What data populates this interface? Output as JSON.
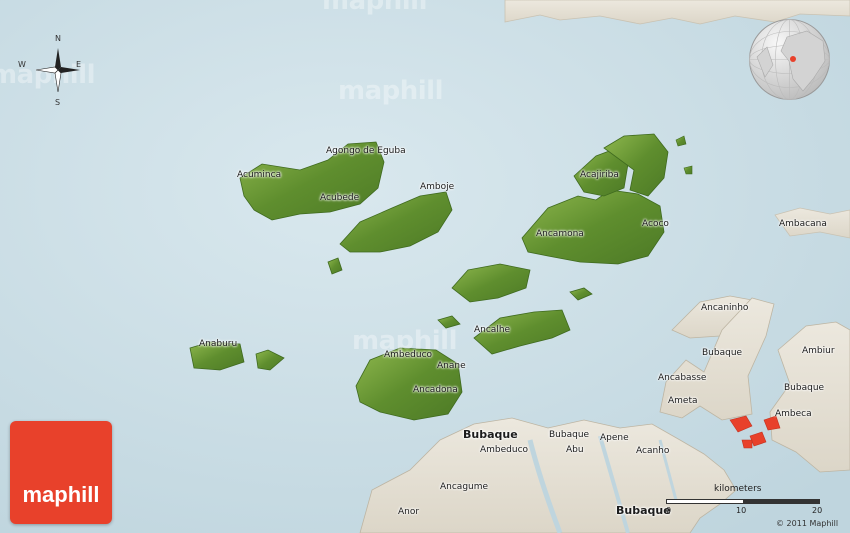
{
  "map": {
    "colors": {
      "sea": "#c9dde6",
      "island": "#6f9a3a",
      "land": "#e6e1d6",
      "marker": "#e8412b"
    },
    "watermarks": [
      "maphill",
      "maphill",
      "maphill",
      "maphill"
    ],
    "labels": [
      {
        "text": "Agongo de Eguba"
      },
      {
        "text": "Acuminca"
      },
      {
        "text": "Acubede"
      },
      {
        "text": "Amboje"
      },
      {
        "text": "Acajiriba"
      },
      {
        "text": "Ancamona"
      },
      {
        "text": "Acoco"
      },
      {
        "text": "Ambacana"
      },
      {
        "text": "Anaburu"
      },
      {
        "text": "Ancalhe"
      },
      {
        "text": "Ambeduco"
      },
      {
        "text": "Anane"
      },
      {
        "text": "Ancadona"
      },
      {
        "text": "Ancaninho"
      },
      {
        "text": "Bubaque"
      },
      {
        "text": "Ambiur"
      },
      {
        "text": "Ancabasse"
      },
      {
        "text": "Bubaque"
      },
      {
        "text": "Ameta"
      },
      {
        "text": "Ambeca"
      },
      {
        "text": "Bubaque"
      },
      {
        "text": "Bubaque"
      },
      {
        "text": "Ambeduco"
      },
      {
        "text": "Abu"
      },
      {
        "text": "Apene"
      },
      {
        "text": "Acanho"
      },
      {
        "text": "Ancagume"
      },
      {
        "text": "Anor"
      },
      {
        "text": "Bubaque"
      }
    ],
    "compass": {
      "n": "N",
      "s": "S",
      "e": "E",
      "w": "W"
    },
    "scale": {
      "title": "kilometers",
      "ticks": [
        "0",
        "10",
        "20"
      ]
    },
    "logo": "maphill",
    "copyright": "© 2011 Maphill"
  }
}
